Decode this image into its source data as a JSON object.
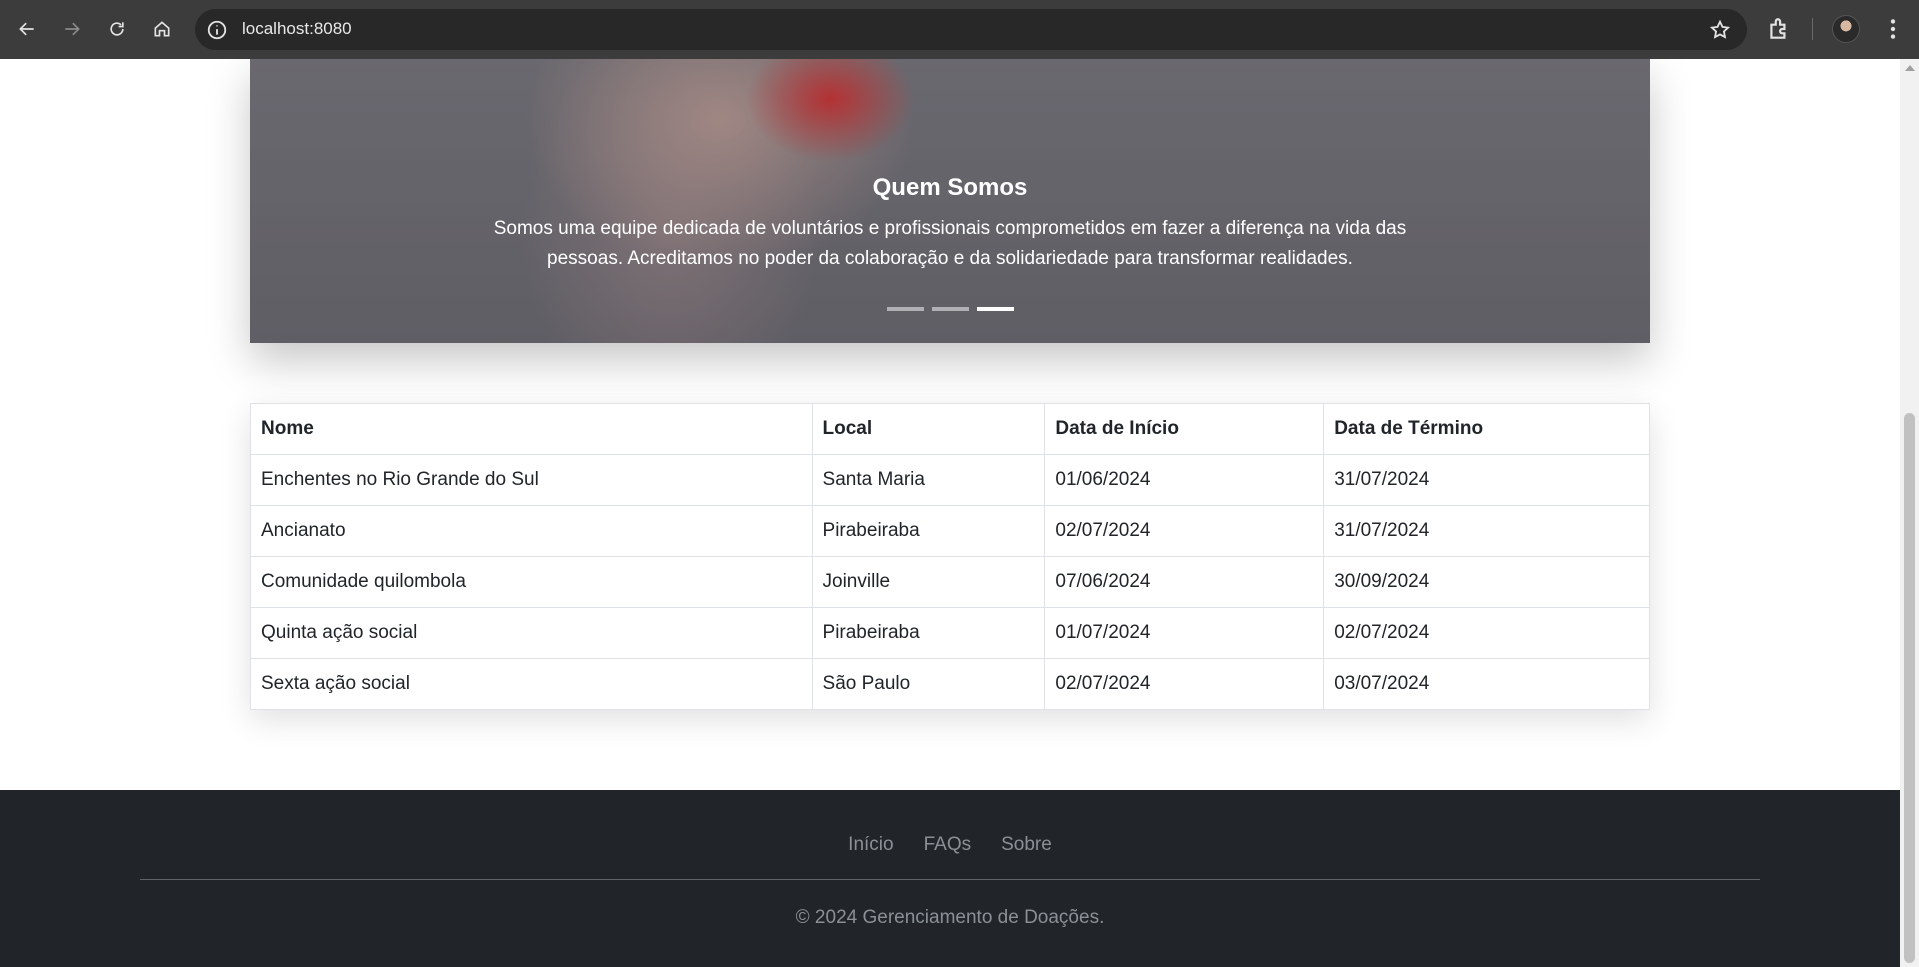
{
  "browser": {
    "url": "localhost:8080",
    "icons": [
      "back-icon",
      "forward-icon",
      "reload-icon",
      "home-icon",
      "site-info-icon",
      "bookmark-star-icon",
      "extensions-icon",
      "profile-avatar",
      "more-menu-icon"
    ]
  },
  "carousel": {
    "title": "Quem Somos",
    "text": "Somos uma equipe dedicada de voluntários e profissionais comprometidos em fazer a diferença na vida das pessoas. Acreditamos no poder da colaboração e da solidariedade para transformar realidades.",
    "indicator_count": 3,
    "active_index": 2
  },
  "table": {
    "headers": [
      "Nome",
      "Local",
      "Data de Início",
      "Data de Término"
    ],
    "rows": [
      [
        "Enchentes no Rio Grande do Sul",
        "Santa Maria",
        "01/06/2024",
        "31/07/2024"
      ],
      [
        "Ancianato",
        "Pirabeiraba",
        "02/07/2024",
        "31/07/2024"
      ],
      [
        "Comunidade quilombola",
        "Joinville",
        "07/06/2024",
        "30/09/2024"
      ],
      [
        "Quinta ação social",
        "Pirabeiraba",
        "01/07/2024",
        "02/07/2024"
      ],
      [
        "Sexta ação social",
        "São Paulo",
        "02/07/2024",
        "03/07/2024"
      ]
    ]
  },
  "footer": {
    "links": [
      "Início",
      "FAQs",
      "Sobre"
    ],
    "copyright": "© 2024 Gerenciamento de Doações."
  },
  "colors": {
    "chrome_bg": "#3c3c3c",
    "footer_bg": "#212529",
    "table_border": "#dee2e6"
  }
}
